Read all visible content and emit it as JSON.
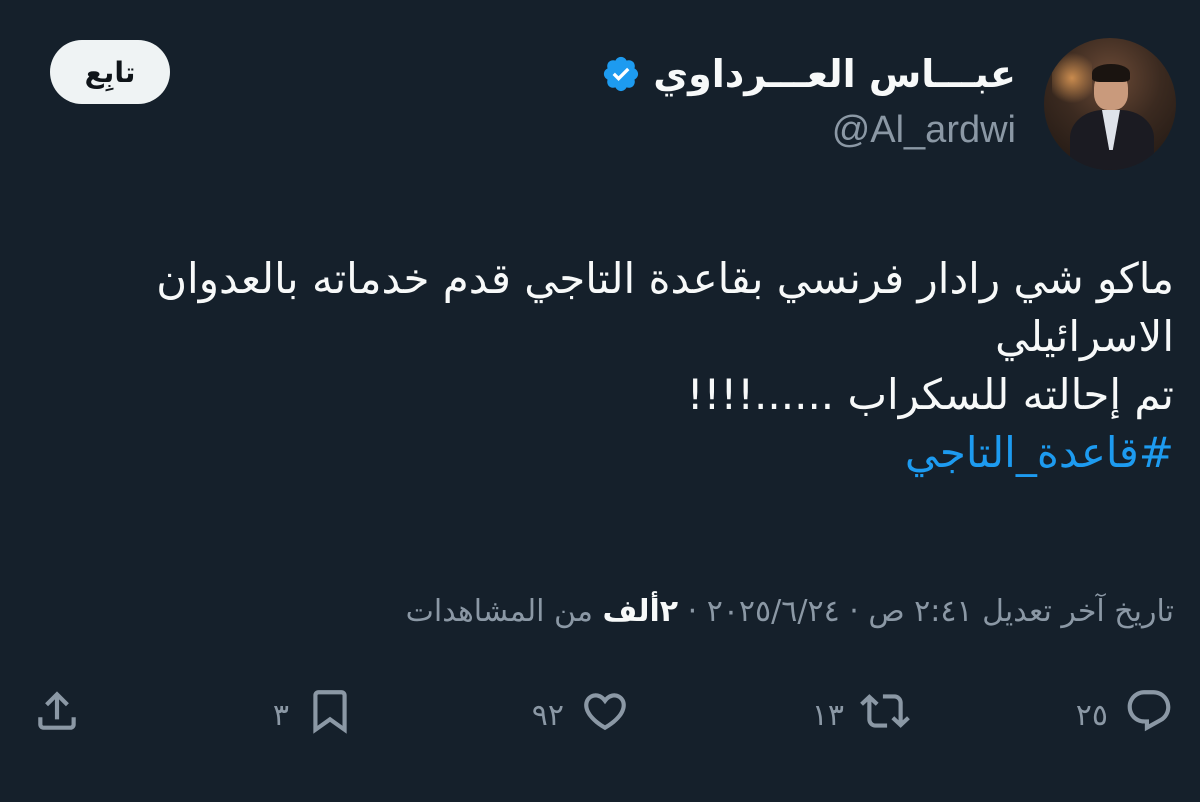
{
  "user": {
    "display_name": "عبـــاس العـــرداوي",
    "handle": "@Al_ardwi",
    "verified": true
  },
  "follow_button": {
    "label": "تابِع"
  },
  "tweet": {
    "lines": [
      "ماكو شي رادار فرنسي بقاعدة التاجي قدم خدماته بالعدوان",
      "الاسرائيلي",
      "تم إحالته للسكراب ......!!!!"
    ],
    "hashtag": "#قاعدة_التاجي"
  },
  "meta": {
    "edited_label": "تاريخ آخر تعديل",
    "time": "٢:٤١ ص",
    "date": "٢٠٢٥/٦/٢٤",
    "views_count": "٢ألف",
    "views_label": "من المشاهدات"
  },
  "actions": {
    "replies": "٢٥",
    "retweets": "١٣",
    "likes": "٩٢",
    "bookmarks": "٣"
  },
  "colors": {
    "background": "#15202b",
    "text": "#f7f9f9",
    "secondary": "#8b98a5",
    "accent": "#1d9bf0"
  }
}
